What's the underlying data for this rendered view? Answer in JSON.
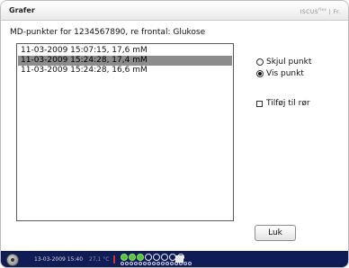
{
  "window": {
    "title": "Grafer",
    "brand": "ISCUS",
    "brand_sup": "flex",
    "brand_suffix": "| Fr."
  },
  "subtitle": "MD-punkter for 1234567890, re frontal: Glukose",
  "list": {
    "items": [
      "11-03-2009 15:07:15, 17,6 mM",
      "11-03-2009 15:24:28, 17,4 mM",
      "11-03-2009 15:24:28, 16,6 mM"
    ],
    "selected_index": 1
  },
  "options": {
    "hide_point": "Skjul punkt",
    "show_point": "Vis punkt",
    "selected": "show_point",
    "add_to_tube": "Tilføj til rør",
    "add_to_tube_checked": false
  },
  "buttons": {
    "close": "Luk"
  },
  "statusbar": {
    "datetime": "13-03-2009 15:40",
    "temperature": "27,1 °C",
    "slots_total": 8,
    "slots_green": [
      0,
      1,
      2
    ]
  }
}
